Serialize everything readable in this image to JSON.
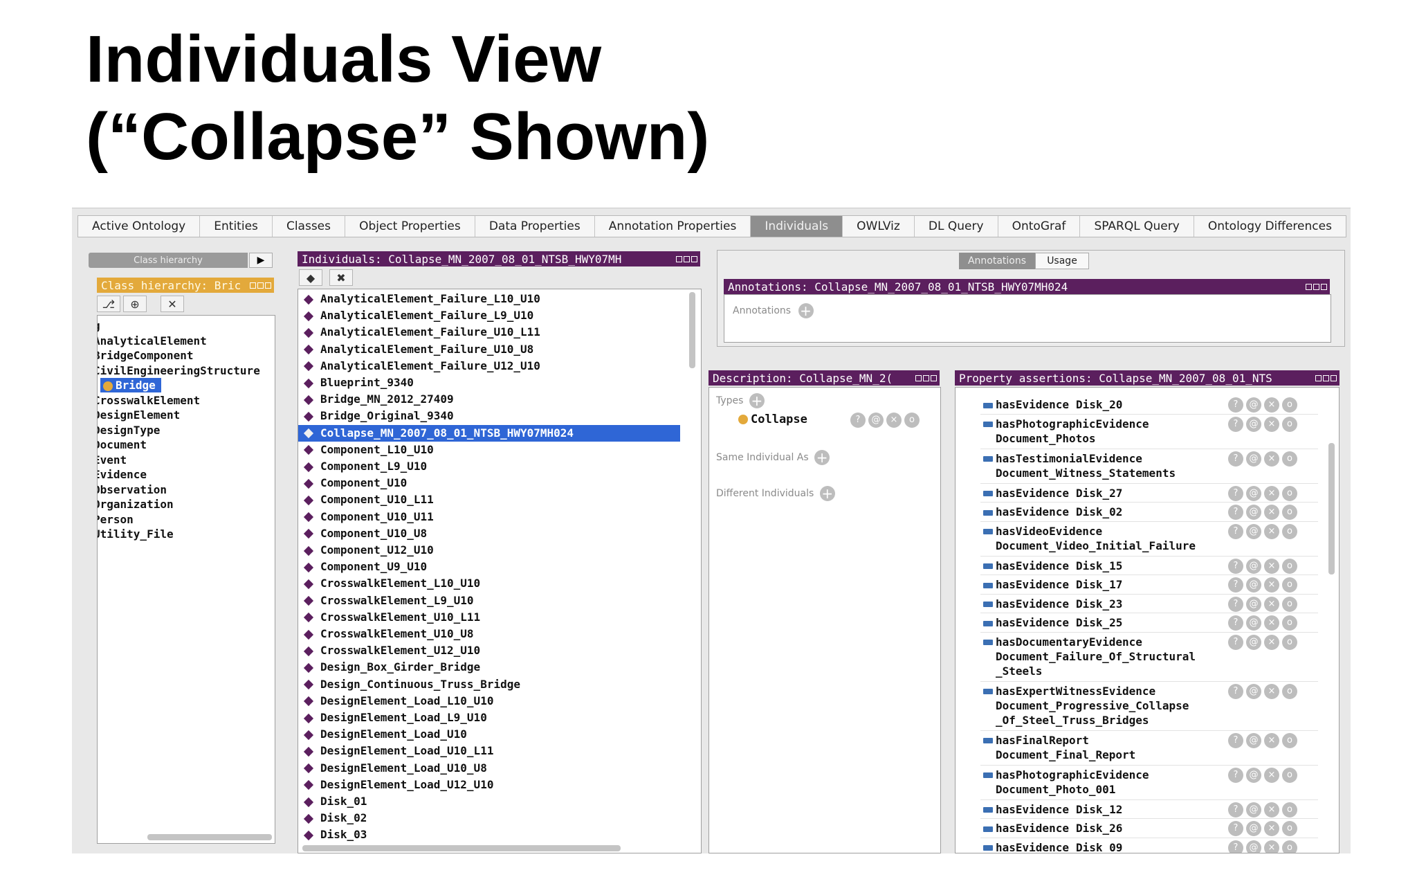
{
  "slide": {
    "title_line1": "Individuals View",
    "title_line2": "(“Collapse” Shown)"
  },
  "tabs": [
    "Active Ontology",
    "Entities",
    "Classes",
    "Object Properties",
    "Data Properties",
    "Annotation Properties",
    "Individuals",
    "OWLViz",
    "DL Query",
    "OntoGraf",
    "SPARQL Query",
    "Ontology Differences"
  ],
  "active_tab": "Individuals",
  "class_pane": {
    "tab_label": "Class hierarchy",
    "header": "Class hierarchy: Bric",
    "items": [
      "g",
      "AnalyticalElement",
      "BridgeComponent",
      "CivilEngineeringStructure",
      "Bridge",
      "CrosswalkElement",
      "DesignElement",
      "DesignType",
      "Document",
      "Event",
      "Evidence",
      "Observation",
      "Organization",
      "Person",
      "Utility_File"
    ],
    "selected": "Bridge"
  },
  "individuals_pane": {
    "header": "Individuals: Collapse_MN_2007_08_01_NTSB_HWY07MH",
    "items": [
      "AnalyticalElement_Failure_L10_U10",
      "AnalyticalElement_Failure_L9_U10",
      "AnalyticalElement_Failure_U10_L11",
      "AnalyticalElement_Failure_U10_U8",
      "AnalyticalElement_Failure_U12_U10",
      "Blueprint_9340",
      "Bridge_MN_2012_27409",
      "Bridge_Original_9340",
      "Collapse_MN_2007_08_01_NTSB_HWY07MH024",
      "Component_L10_U10",
      "Component_L9_U10",
      "Component_U10",
      "Component_U10_L11",
      "Component_U10_U11",
      "Component_U10_U8",
      "Component_U12_U10",
      "Component_U9_U10",
      "CrosswalkElement_L10_U10",
      "CrosswalkElement_L9_U10",
      "CrosswalkElement_U10_L11",
      "CrosswalkElement_U10_U8",
      "CrosswalkElement_U12_U10",
      "Design_Box_Girder_Bridge",
      "Design_Continuous_Truss_Bridge",
      "DesignElement_Load_L10_U10",
      "DesignElement_Load_L9_U10",
      "DesignElement_Load_U10",
      "DesignElement_Load_U10_L11",
      "DesignElement_Load_U10_U8",
      "DesignElement_Load_U12_U10",
      "Disk_01",
      "Disk_02",
      "Disk_03"
    ],
    "selected": "Collapse_MN_2007_08_01_NTSB_HWY07MH024"
  },
  "annotations_pane": {
    "toggle": [
      "Annotations",
      "Usage"
    ],
    "header": "Annotations: Collapse_MN_2007_08_01_NTSB_HWY07MH024",
    "label": "Annotations"
  },
  "description_pane": {
    "header": "Description: Collapse_MN_2(",
    "types_label": "Types",
    "type_value": "Collapse",
    "same_label": "Same Individual As",
    "different_label": "Different Individuals"
  },
  "property_pane": {
    "header": "Property assertions: Collapse_MN_2007_08_01_NTS",
    "assertions": [
      {
        "property": "hasEvidence",
        "value": "Disk_20"
      },
      {
        "property": "hasPhotographicEvidence",
        "value": "Document_Photos"
      },
      {
        "property": "hasTestimonialEvidence",
        "value": "Document_Witness_Statements"
      },
      {
        "property": "hasEvidence",
        "value": "Disk_27"
      },
      {
        "property": "hasEvidence",
        "value": "Disk_02"
      },
      {
        "property": "hasVideoEvidence",
        "value": "Document_Video_Initial_Failure"
      },
      {
        "property": "hasEvidence",
        "value": "Disk_15"
      },
      {
        "property": "hasEvidence",
        "value": "Disk_17"
      },
      {
        "property": "hasEvidence",
        "value": "Disk_23"
      },
      {
        "property": "hasEvidence",
        "value": "Disk_25"
      },
      {
        "property": "hasDocumentaryEvidence",
        "value": "Document_Failure_Of_Structural\n_Steels"
      },
      {
        "property": "hasExpertWitnessEvidence",
        "value": "Document_Progressive_Collapse\n_Of_Steel_Truss_Bridges"
      },
      {
        "property": "hasFinalReport",
        "value": "Document_Final_Report"
      },
      {
        "property": "hasPhotographicEvidence",
        "value": "Document_Photo_001"
      },
      {
        "property": "hasEvidence",
        "value": "Disk_12"
      },
      {
        "property": "hasEvidence",
        "value": "Disk_26"
      },
      {
        "property": "hasEvidence",
        "value": "Disk_09"
      }
    ]
  },
  "icons": {
    "help": "?",
    "annotate": "@",
    "delete": "×",
    "edit": "o",
    "add": "+"
  }
}
